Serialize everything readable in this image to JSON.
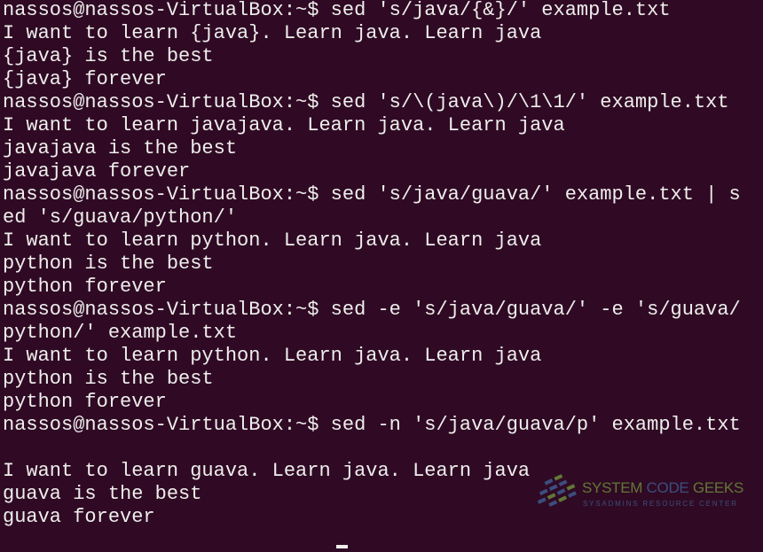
{
  "terminal": {
    "background": "#300a24",
    "foreground": "#eeeeec",
    "lines": [
      "nassos@nassos-VirtualBox:~$ sed 's/java/{&}/' example.txt",
      "I want to learn {java}. Learn java. Learn java",
      "{java} is the best",
      "{java} forever",
      "nassos@nassos-VirtualBox:~$ sed 's/\\(java\\)/\\1\\1/' example.txt",
      "I want to learn javajava. Learn java. Learn java",
      "javajava is the best",
      "javajava forever",
      "nassos@nassos-VirtualBox:~$ sed 's/java/guava/' example.txt | s",
      "ed 's/guava/python/'",
      "I want to learn python. Learn java. Learn java",
      "python is the best",
      "python forever",
      "nassos@nassos-VirtualBox:~$ sed -e 's/java/guava/' -e 's/guava/",
      "python/' example.txt",
      "I want to learn python. Learn java. Learn java",
      "python is the best",
      "python forever",
      "nassos@nassos-VirtualBox:~$ sed -n 's/java/guava/p' example.txt",
      "",
      "I want to learn guava. Learn java. Learn java",
      "guava is the best",
      "guava forever"
    ]
  },
  "watermark": {
    "title_part1": "SYSTEM",
    "title_part2": "CODE",
    "title_part3": "GEEKS",
    "subtitle": "SYSADMINS RESOURCE CENTER",
    "colors": {
      "green": "#6a8a3a",
      "blue": "#3f5a8e"
    }
  }
}
